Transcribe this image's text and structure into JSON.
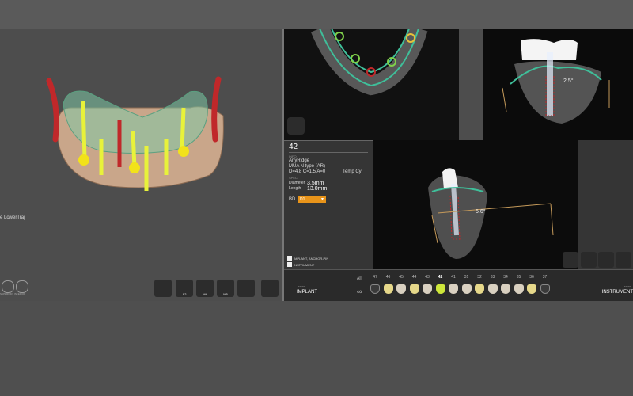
{
  "left_panel": {
    "trajectory_label": "e LowerTraj",
    "small_icons": [
      {
        "name": "superior-view-icon",
        "label": "SUPERIOR"
      },
      {
        "name": "inferior-view-icon",
        "label": "INFERIOR"
      }
    ],
    "toolbar": [
      {
        "name": "face-icon",
        "label": ""
      },
      {
        "name": "arch-a2-icon",
        "label": "A2"
      },
      {
        "name": "arch-m4-icon",
        "label": "M4"
      },
      {
        "name": "arch-m5-icon",
        "label": "M5"
      },
      {
        "name": "video-icon",
        "label": ""
      },
      {
        "name": "eye-visibility-icon",
        "label": ""
      }
    ]
  },
  "info_panel": {
    "tooth_number": "42",
    "section_label": "INFO",
    "brand": "AnyRidge",
    "product": "MUA N type (AR)",
    "spec_line": "D=4.8 C=1.5 A=0",
    "temp": "Temp Cyl",
    "spec_header": "SPEC",
    "diameter_label": "Diameter",
    "diameter_value": "3.5mm",
    "length_label": "Length",
    "length_value": "13.0mm",
    "bd_label": "BD",
    "bd_value": "D1",
    "checkboxes": [
      {
        "label": "IMPLANT, ANCHOR-PIN",
        "checked": true
      },
      {
        "label": "INSTRUMENT",
        "checked": true
      }
    ]
  },
  "cross_section_1": {
    "angle": "2.5°"
  },
  "cross_section_2": {
    "angle": "5.6°"
  },
  "tooth_bar": {
    "all_label": "All",
    "mode_left_caption": "MODE",
    "mode_left": "IMPLANT",
    "mode_right_caption": "MODE",
    "mode_right": "INSTRUMENT",
    "teeth": [
      {
        "num": "47",
        "state": "empty"
      },
      {
        "num": "46",
        "state": "imp"
      },
      {
        "num": "45",
        "state": "crown"
      },
      {
        "num": "44",
        "state": "imp"
      },
      {
        "num": "43",
        "state": "crown"
      },
      {
        "num": "42",
        "state": "sel"
      },
      {
        "num": "41",
        "state": "crown"
      },
      {
        "num": "31",
        "state": "crown"
      },
      {
        "num": "32",
        "state": "imp"
      },
      {
        "num": "33",
        "state": "crown"
      },
      {
        "num": "34",
        "state": "crown"
      },
      {
        "num": "35",
        "state": "crown"
      },
      {
        "num": "36",
        "state": "imp"
      },
      {
        "num": "37",
        "state": "empty"
      }
    ]
  },
  "colors": {
    "implant_yellow": "#e8f23a",
    "nerve_red": "#c0282a",
    "bd_orange": "#e8941a",
    "gum_green": "#3fbf9a"
  }
}
